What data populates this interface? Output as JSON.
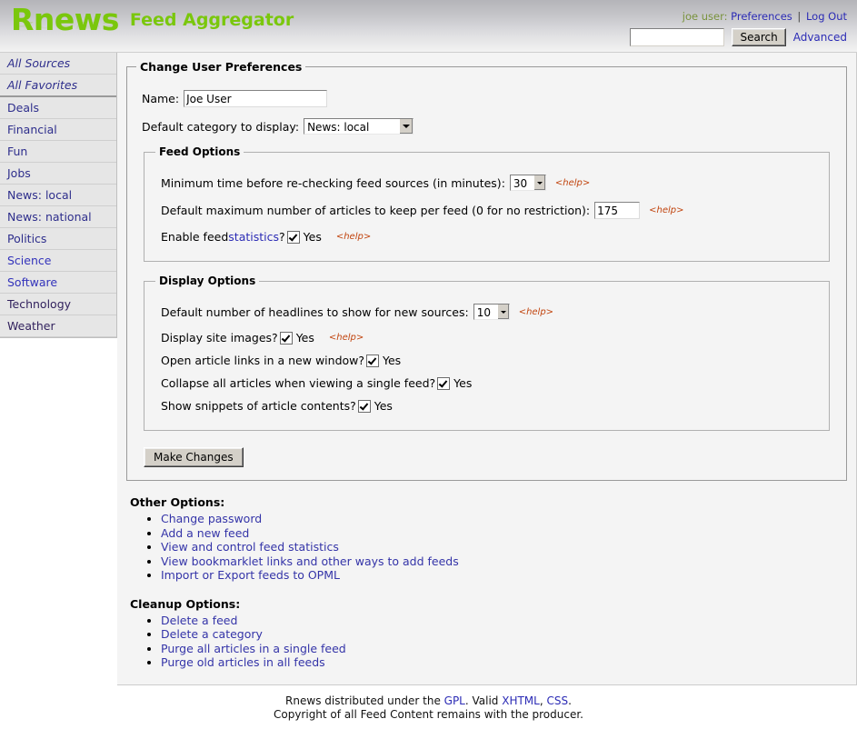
{
  "header": {
    "logo_text": "Rnews",
    "app_title": "Feed Aggregator",
    "user_label": "joe user:",
    "preferences_link": "Preferences",
    "separator": "|",
    "logout_link": "Log Out",
    "search_value": "",
    "search_placeholder": "",
    "search_button": "Search",
    "advanced_link": "Advanced",
    "brand_color": "#7ac70c",
    "link_color": "#2b2bb5",
    "user_color": "#79923d"
  },
  "sidebar": {
    "items": [
      {
        "label": "All Sources",
        "style": "italic"
      },
      {
        "label": "All Favorites",
        "style": "italic-sep"
      },
      {
        "label": "Deals",
        "style": "normal"
      },
      {
        "label": "Financial",
        "style": "normal"
      },
      {
        "label": "Fun",
        "style": "normal"
      },
      {
        "label": "Jobs",
        "style": "normal"
      },
      {
        "label": "News: local",
        "style": "normal"
      },
      {
        "label": "News: national",
        "style": "normal"
      },
      {
        "label": "Politics",
        "style": "normal"
      },
      {
        "label": "Science",
        "style": "blue"
      },
      {
        "label": "Software",
        "style": "blue"
      },
      {
        "label": "Technology",
        "style": "dark"
      },
      {
        "label": "Weather",
        "style": "dark"
      }
    ]
  },
  "main": {
    "legend": "Change User Preferences",
    "name_label": "Name:",
    "name_value": "Joe User",
    "default_category_label": "Default category to display:",
    "default_category_value": "News: local",
    "feed_options": {
      "legend": "Feed Options",
      "recheck_label": "Minimum time before re-checking feed sources (in minutes):",
      "recheck_value": "30",
      "recheck_help": "<help>",
      "maxarticles_label": "Default maximum number of articles to keep per feed (0 for no restriction):",
      "maxarticles_value": "175",
      "maxarticles_help": "<help>",
      "stats_label_pre": "Enable feed ",
      "stats_link": "statistics",
      "stats_label_post": "?",
      "stats_yes": "Yes",
      "stats_help": "<help>"
    },
    "display_options": {
      "legend": "Display Options",
      "headlines_label": "Default number of headlines to show for new sources:",
      "headlines_value": "10",
      "headlines_help": "<help>",
      "siteimages_label": "Display site images?",
      "siteimages_yes": "Yes",
      "siteimages_help": "<help>",
      "newwindow_label": "Open article links in a new window?",
      "newwindow_yes": "Yes",
      "collapse_label": "Collapse all articles when viewing a single feed?",
      "collapse_yes": "Yes",
      "snippets_label": "Show snippets of article contents?",
      "snippets_yes": "Yes"
    },
    "submit_label": "Make Changes",
    "other_options_title": "Other Options:",
    "other_options": [
      "Change password",
      "Add a new feed",
      "View and control feed statistics",
      "View bookmarklet links and other ways to add feeds",
      "Import or Export feeds to OPML"
    ],
    "cleanup_options_title": "Cleanup Options:",
    "cleanup_options": [
      "Delete a feed",
      "Delete a category",
      "Purge all articles in a single feed",
      "Purge old articles in all feeds"
    ]
  },
  "footer": {
    "line1_a": "Rnews distributed under the ",
    "gpl": "GPL",
    "line1_b": ". Valid ",
    "xhtml": "XHTML",
    "line1_c": ", ",
    "css": "CSS",
    "line1_d": ".",
    "line2": "Copyright of all Feed Content remains with the producer."
  }
}
